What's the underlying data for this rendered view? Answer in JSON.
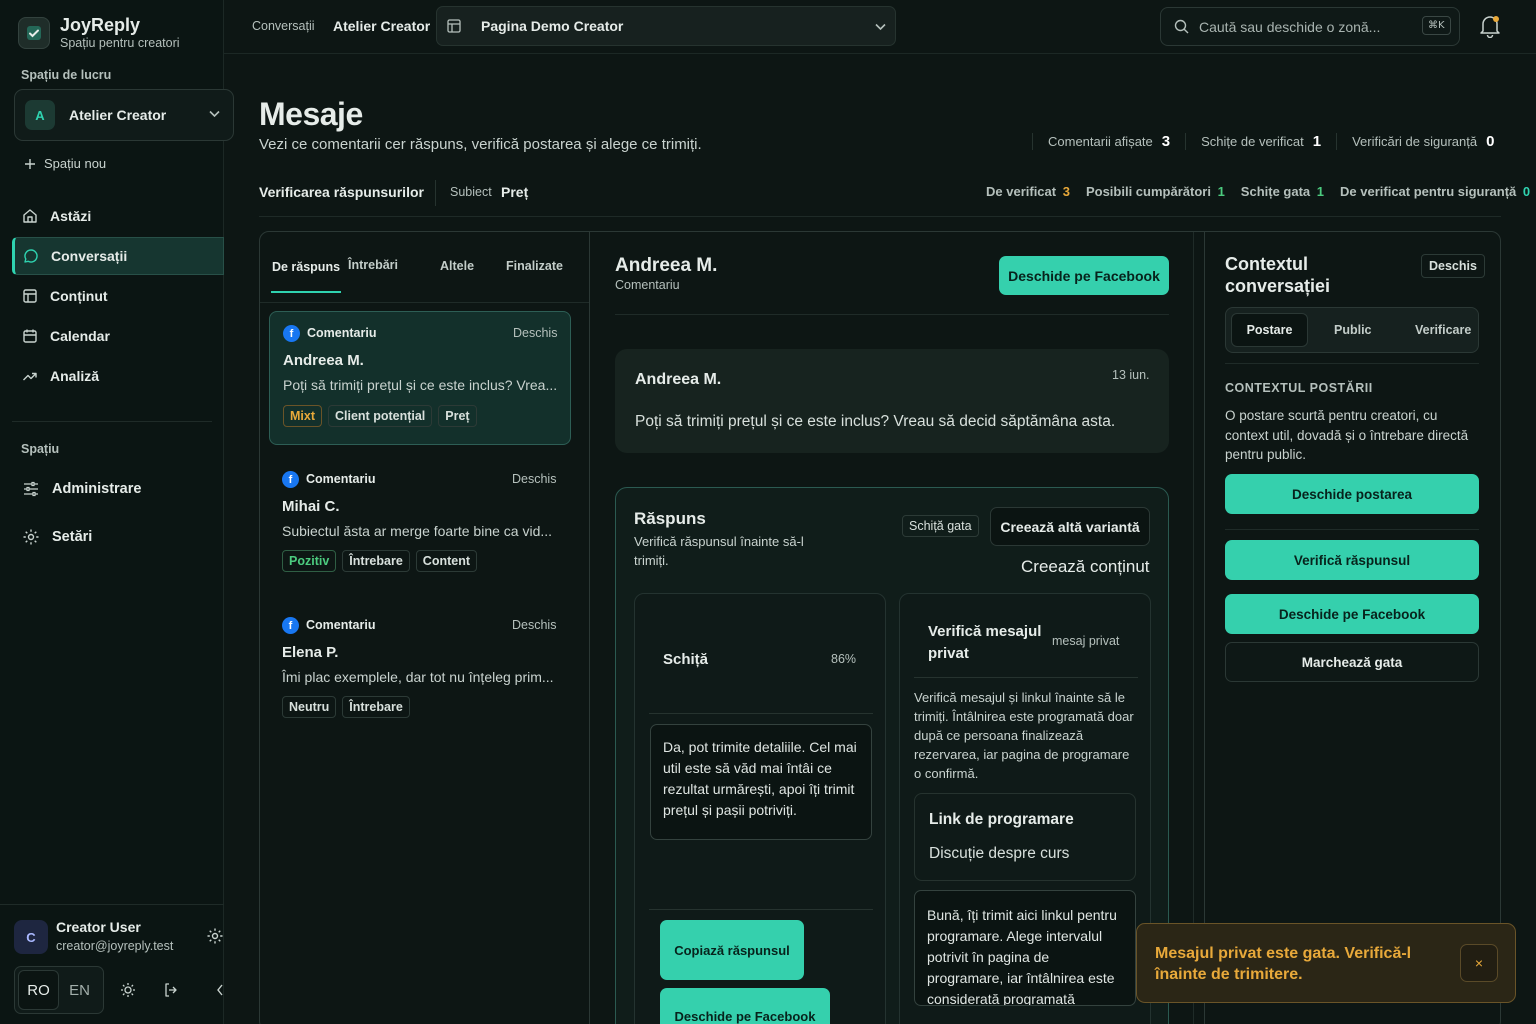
{
  "app": {
    "name": "JoyReply",
    "tagline": "Spațiu pentru creatori"
  },
  "sidebar": {
    "workspace_label": "Spațiu de lucru",
    "workspace": {
      "initial": "A",
      "name": "Atelier Creator"
    },
    "new_space": "Spațiu nou",
    "nav": [
      {
        "label": "Astăzi",
        "icon": "home-icon"
      },
      {
        "label": "Conversații",
        "icon": "chat-icon",
        "active": true
      },
      {
        "label": "Conținut",
        "icon": "layout-icon"
      },
      {
        "label": "Calendar",
        "icon": "calendar-icon"
      },
      {
        "label": "Analiză",
        "icon": "trend-icon"
      }
    ],
    "space_label": "Spațiu",
    "space_nav": [
      {
        "label": "Administrare",
        "icon": "sliders-icon"
      },
      {
        "label": "Setări",
        "icon": "gear-icon"
      }
    ],
    "user": {
      "initial": "C",
      "name": "Creator User",
      "email": "creator@joyreply.test"
    },
    "lang": {
      "ro": "RO",
      "en": "EN"
    }
  },
  "topbar": {
    "breadcrumb_section": "Conversații",
    "breadcrumb_current": "Atelier Creator",
    "page_select": "Pagina Demo Creator",
    "search_placeholder": "Caută sau deschide o zonă...",
    "search_shortcut": "⌘K"
  },
  "header": {
    "title": "Mesaje",
    "subtitle": "Vezi ce comentarii cer răspuns, verifică postarea și alege ce trimiți.",
    "stats": [
      {
        "label": "Comentarii afișate",
        "value": "3"
      },
      {
        "label": "Schițe de verificat",
        "value": "1"
      },
      {
        "label": "Verificări de siguranță",
        "value": "0"
      }
    ],
    "review_label": "Verificarea răspunsurilor",
    "subject_label": "Subiect",
    "subject_value": "Preț",
    "counters": [
      {
        "label": "De verificat",
        "value": "3",
        "color": "#e8a93a"
      },
      {
        "label": "Posibili cumpărători",
        "value": "1",
        "color": "#4ccb7f"
      },
      {
        "label": "Schițe gata",
        "value": "1",
        "color": "#4ccb7f"
      },
      {
        "label": "De verificat pentru siguranță",
        "value": "0",
        "color": "#2fd3b0"
      }
    ]
  },
  "list": {
    "tabs": [
      "De răspuns",
      "Întrebări",
      "Altele",
      "Finalizate"
    ],
    "items": [
      {
        "type": "Comentariu",
        "status": "Deschis",
        "name": "Andreea M.",
        "preview": "Poți să trimiți prețul și ce este inclus? Vrea...",
        "tags": [
          "Mixt",
          "Client potențial",
          "Preț"
        ]
      },
      {
        "type": "Comentariu",
        "status": "Deschis",
        "name": "Mihai C.",
        "preview": "Subiectul ăsta ar merge foarte bine ca vid...",
        "tags": [
          "Pozitiv",
          "Întrebare",
          "Content"
        ]
      },
      {
        "type": "Comentariu",
        "status": "Deschis",
        "name": "Elena P.",
        "preview": "Îmi plac exemplele, dar tot nu înțeleg prim...",
        "tags": [
          "Neutru",
          "Întrebare"
        ]
      }
    ]
  },
  "thread": {
    "name": "Andreea M.",
    "kind": "Comentariu",
    "open_facebook": "Deschide pe Facebook",
    "message": {
      "author": "Andreea M.",
      "date": "13 iun.",
      "text": "Poți să trimiți prețul și ce este inclus? Vreau să decid săptămâna asta."
    },
    "reply": {
      "title": "Răspuns",
      "hint": "Verifică răspunsul înainte să-l trimiți.",
      "status": "Schiță gata",
      "new_variant": "Creează altă variantă",
      "create_content": "Creează conținut",
      "draft": {
        "title": "Schiță",
        "score": "86%",
        "text": "Da, pot trimite detaliile. Cel mai util este să văd mai întâi ce rezultat urmărești, apoi îți trimit prețul și pașii potriviți.",
        "copy": "Copiază răspunsul",
        "open_facebook": "Deschide pe Facebook"
      },
      "private": {
        "title": "Verifică mesajul privat",
        "tag": "mesaj privat",
        "desc": "Verifică mesajul și linkul înainte să le trimiți. Întâlnirea este programată doar după ce persoana finalizează rezervarea, iar pagina de programare o confirmă.",
        "link_title": "Link de programare",
        "link_value": "Discuție despre curs",
        "text": "Bună, îți trimit aici linkul pentru programare. Alege intervalul potrivit în pagina de programare, iar întâlnirea este considerată programată"
      }
    }
  },
  "context": {
    "title": "Contextul conversației",
    "status": "Deschis",
    "tabs": [
      "Postare",
      "Public",
      "Verificare"
    ],
    "post_label": "CONTEXTUL POSTĂRII",
    "post_text": "O postare scurtă pentru creatori, cu context util, dovadă și o întrebare directă pentru public.",
    "open_post": "Deschide postarea",
    "check_reply": "Verifică răspunsul",
    "open_facebook": "Deschide pe Facebook",
    "mark_done": "Marchează gata"
  },
  "toast": {
    "text": "Mesajul privat este gata. Verifică-l înainte de trimitere.",
    "close": "×"
  },
  "colors": {
    "accent": "#35d0ad",
    "warning": "#e8a93a",
    "positive": "#4ccb7f",
    "facebook": "#1877f2"
  }
}
